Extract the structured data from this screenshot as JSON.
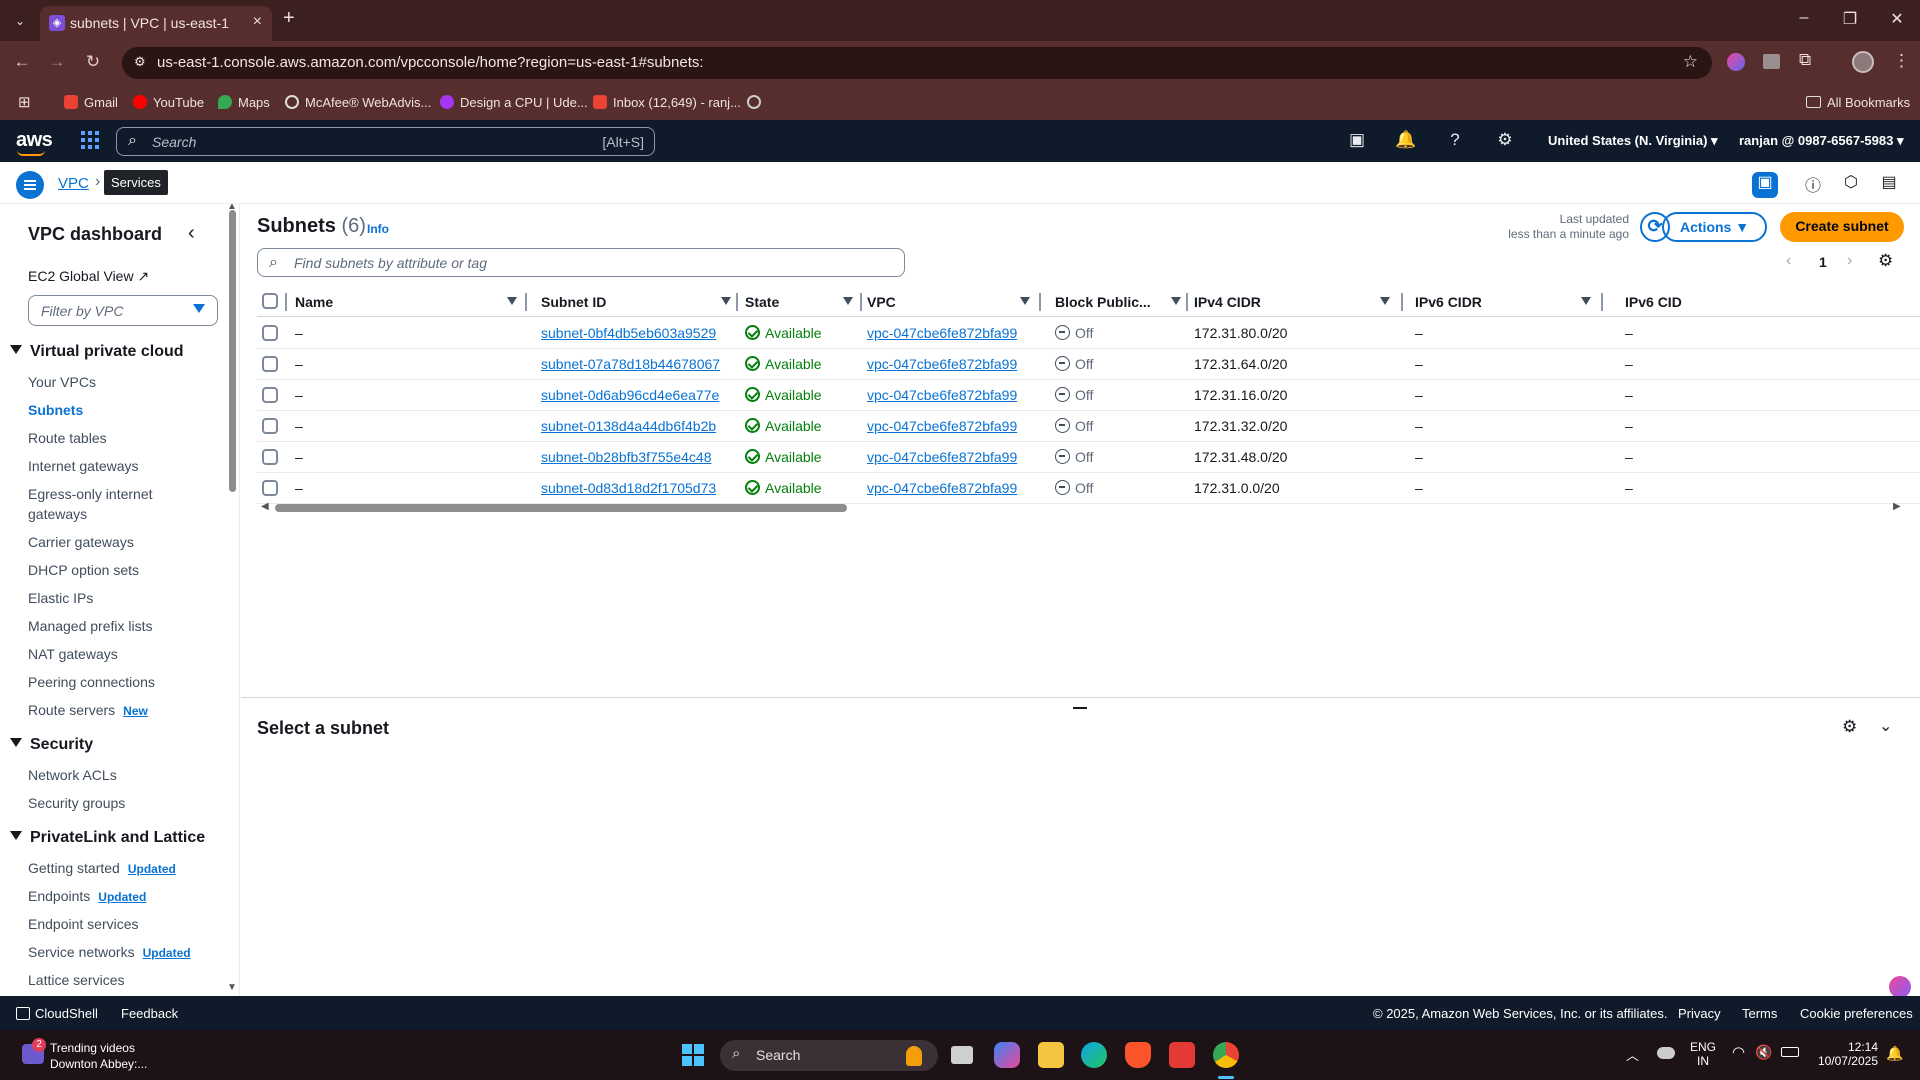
{
  "browser": {
    "tab_title": "subnets | VPC | us-east-1",
    "url": "us-east-1.console.aws.amazon.com/vpcconsole/home?region=us-east-1#subnets:",
    "bookmarks": [
      "Gmail",
      "YouTube",
      "Maps",
      "McAfee® WebAdvis...",
      "Design a CPU | Ude...",
      "Inbox (12,649) - ranj..."
    ],
    "all_bookmarks": "All Bookmarks"
  },
  "awsnav": {
    "logo": "aws",
    "search_placeholder": "Search",
    "search_shortcut": "[Alt+S]",
    "region": "United States (N. Virginia)",
    "account": "ranjan @ 0987-6567-5983"
  },
  "breadcrumb": {
    "root": "VPC",
    "tooltip": "Services",
    "current": "s"
  },
  "sidebar": {
    "title": "VPC dashboard",
    "ec2_global_view": "EC2 Global View",
    "filter_placeholder": "Filter by VPC",
    "sections": [
      {
        "title": "Virtual private cloud",
        "items": [
          {
            "label": "Your VPCs"
          },
          {
            "label": "Subnets",
            "active": true
          },
          {
            "label": "Route tables"
          },
          {
            "label": "Internet gateways"
          },
          {
            "label": "Egress-only internet gateways"
          },
          {
            "label": "Carrier gateways"
          },
          {
            "label": "DHCP option sets"
          },
          {
            "label": "Elastic IPs"
          },
          {
            "label": "Managed prefix lists"
          },
          {
            "label": "NAT gateways"
          },
          {
            "label": "Peering connections"
          },
          {
            "label": "Route servers",
            "badge": "New"
          }
        ]
      },
      {
        "title": "Security",
        "items": [
          {
            "label": "Network ACLs"
          },
          {
            "label": "Security groups"
          }
        ]
      },
      {
        "title": "PrivateLink and Lattice",
        "items": [
          {
            "label": "Getting started",
            "badge": "Updated"
          },
          {
            "label": "Endpoints",
            "badge": "Updated"
          },
          {
            "label": "Endpoint services"
          },
          {
            "label": "Service networks",
            "badge": "Updated"
          },
          {
            "label": "Lattice services"
          }
        ]
      }
    ]
  },
  "main": {
    "title": "Subnets",
    "count": "(6)",
    "info": "Info",
    "last_updated_label": "Last updated",
    "last_updated_value": "less than a minute ago",
    "actions": "Actions",
    "create": "Create subnet",
    "search_placeholder": "Find subnets by attribute or tag",
    "page": "1",
    "columns": [
      "Name",
      "Subnet ID",
      "State",
      "VPC",
      "Block Public...",
      "IPv4 CIDR",
      "IPv6 CIDR",
      "IPv6 CID"
    ],
    "rows": [
      {
        "name": "–",
        "subnet_id": "subnet-0bf4db5eb603a9529",
        "state": "Available",
        "vpc": "vpc-047cbe6fe872bfa99",
        "block": "Off",
        "ipv4": "172.31.80.0/20",
        "ipv6": "–",
        "ipv6b": "–"
      },
      {
        "name": "–",
        "subnet_id": "subnet-07a78d18b44678067",
        "state": "Available",
        "vpc": "vpc-047cbe6fe872bfa99",
        "block": "Off",
        "ipv4": "172.31.64.0/20",
        "ipv6": "–",
        "ipv6b": "–"
      },
      {
        "name": "–",
        "subnet_id": "subnet-0d6ab96cd4e6ea77e",
        "state": "Available",
        "vpc": "vpc-047cbe6fe872bfa99",
        "block": "Off",
        "ipv4": "172.31.16.0/20",
        "ipv6": "–",
        "ipv6b": "–"
      },
      {
        "name": "–",
        "subnet_id": "subnet-0138d4a44db6f4b2b",
        "state": "Available",
        "vpc": "vpc-047cbe6fe872bfa99",
        "block": "Off",
        "ipv4": "172.31.32.0/20",
        "ipv6": "–",
        "ipv6b": "–"
      },
      {
        "name": "–",
        "subnet_id": "subnet-0b28bfb3f755e4c48",
        "state": "Available",
        "vpc": "vpc-047cbe6fe872bfa99",
        "block": "Off",
        "ipv4": "172.31.48.0/20",
        "ipv6": "–",
        "ipv6b": "–"
      },
      {
        "name": "–",
        "subnet_id": "subnet-0d83d18d2f1705d73",
        "state": "Available",
        "vpc": "vpc-047cbe6fe872bfa99",
        "block": "Off",
        "ipv4": "172.31.0.0/20",
        "ipv6": "–",
        "ipv6b": "–"
      }
    ],
    "split_title": "Select a subnet"
  },
  "footer": {
    "cloudshell": "CloudShell",
    "feedback": "Feedback",
    "copyright": "© 2025, Amazon Web Services, Inc. or its affiliates.",
    "privacy": "Privacy",
    "terms": "Terms",
    "cookies": "Cookie preferences"
  },
  "taskbar": {
    "widget_title": "Trending videos",
    "widget_sub": "Downton Abbey:...",
    "widget_badge": "2",
    "search": "Search",
    "lang1": "ENG",
    "lang2": "IN",
    "time": "12:14",
    "date": "10/07/2025"
  },
  "colors": {
    "accent": "#0972d3",
    "primary_button": "#ff9900",
    "status_green": "#037f0c",
    "aws_nav": "#0f1b2a",
    "browser_frame": "#572e2e"
  }
}
